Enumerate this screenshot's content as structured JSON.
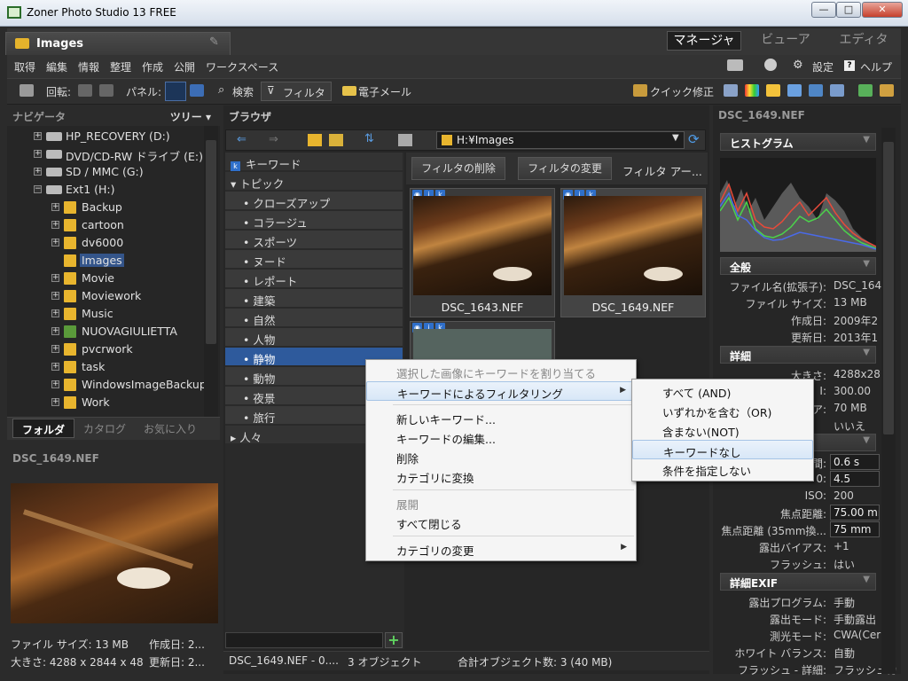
{
  "window": {
    "title": "Zoner Photo Studio 13 FREE",
    "min": "—",
    "max": "□",
    "close": "✕"
  },
  "tabs": {
    "images": "Images"
  },
  "modes": {
    "manager": "マネージャ",
    "viewer": "ビューア",
    "editor": "エディタ"
  },
  "menu": {
    "items": [
      "取得",
      "編集",
      "情報",
      "整理",
      "作成",
      "公開",
      "ワークスペース"
    ],
    "settings": "設定",
    "help": "ヘルプ"
  },
  "toolbar": {
    "rotate": "回転:",
    "panel": "パネル:",
    "search": "検索",
    "filter": "フィルタ",
    "email": "電子メール",
    "quickfix": "クイック修正"
  },
  "navigator": {
    "title": "ナビゲータ",
    "tree_label": "ツリー ▾",
    "items": [
      "HP_RECOVERY (D:)",
      "DVD/CD-RW ドライブ (E:)",
      "SD / MMC (G:)",
      "Ext1 (H:)",
      "Backup",
      "cartoon",
      "dv6000",
      "Images",
      "Movie",
      "Moviework",
      "Music",
      "NUOVAGIULIETTA",
      "pvcrwork",
      "task",
      "WindowsImageBackup",
      "Work"
    ]
  },
  "left_tabs": {
    "folder": "フォルダ",
    "catalog": "カタログ",
    "favorites": "お気に入り"
  },
  "preview": {
    "title": "DSC_1649.NEF",
    "line1a": "ファイル サイズ: 13 MB",
    "line1b": "作成日: 2...",
    "line2a": "大きさ: 4288 x 2844 x 48",
    "line2b": "更新日: 2..."
  },
  "browser": {
    "title": "ブラウザ",
    "path": "H:¥Images"
  },
  "keywords": {
    "header": "キーワード",
    "topic": "▾ トピック",
    "items": [
      "• クローズアップ",
      "• コラージュ",
      "• スポーツ",
      "• ヌード",
      "• レポート",
      "• 建築",
      "• 自然",
      "• 人物",
      "• 静物",
      "• 動物",
      "• 夜景",
      "• 旅行"
    ],
    "people": "▸ 人々"
  },
  "filter": {
    "delete": "フィルタの削除",
    "change": "フィルタの変更",
    "area": "フィルタ アー..."
  },
  "thumbs": [
    {
      "name": "DSC_1643.NEF"
    },
    {
      "name": "DSC_1649.NEF"
    }
  ],
  "status": {
    "file": "DSC_1649.NEF - 0....",
    "objects": "3 オブジェクト",
    "total": "合計オブジェクト数: 3 (40 MB)"
  },
  "props": {
    "title": "DSC_1649.NEF",
    "histogram": "ヒストグラム",
    "general": "全般",
    "general_rows": [
      [
        "ファイル名(拡張子):",
        "DSC_164"
      ],
      [
        "ファイル サイズ:",
        "13 MB"
      ],
      [
        "作成日:",
        "2009年2"
      ],
      [
        "更新日:",
        "2013年1"
      ]
    ],
    "details": "詳細",
    "details_rows": [
      [
        "大きさ:",
        "4288x28"
      ],
      [
        "I:",
        "300.00"
      ],
      [
        "ア:",
        "70 MB"
      ],
      [
        "",
        "いいえ"
      ]
    ],
    "exif_rows": [
      [
        "間:",
        "0.6 s"
      ],
      [
        "0:",
        "4.5"
      ],
      [
        "ISO:",
        "200"
      ],
      [
        "焦点距離:",
        "75.00 mm"
      ],
      [
        "焦点距離 (35mm換...",
        "75 mm"
      ],
      [
        "露出バイアス:",
        "+1"
      ],
      [
        "フラッシュ:",
        "はい"
      ]
    ],
    "exif": "詳細EXIF",
    "exif2_rows": [
      [
        "露出プログラム:",
        "手動"
      ],
      [
        "露出モード:",
        "手動露出"
      ],
      [
        "測光モード:",
        "CWA(Cer"
      ],
      [
        "ホワイト バランス:",
        "自動"
      ],
      [
        "フラッシュ - 詳細:",
        "フラッシュカ"
      ]
    ]
  },
  "context_menu": {
    "items": [
      "選択した画像にキーワードを割り当てる",
      "キーワードによるフィルタリング",
      "新しいキーワード...",
      "キーワードの編集...",
      "削除",
      "カテゴリに変換",
      "展開",
      "すべて閉じる",
      "カテゴリの変更"
    ]
  },
  "submenu": {
    "items": [
      "すべて (AND)",
      "いずれかを含む（OR)",
      "含まない(NOT)",
      "キーワードなし",
      "条件を指定しない"
    ]
  }
}
